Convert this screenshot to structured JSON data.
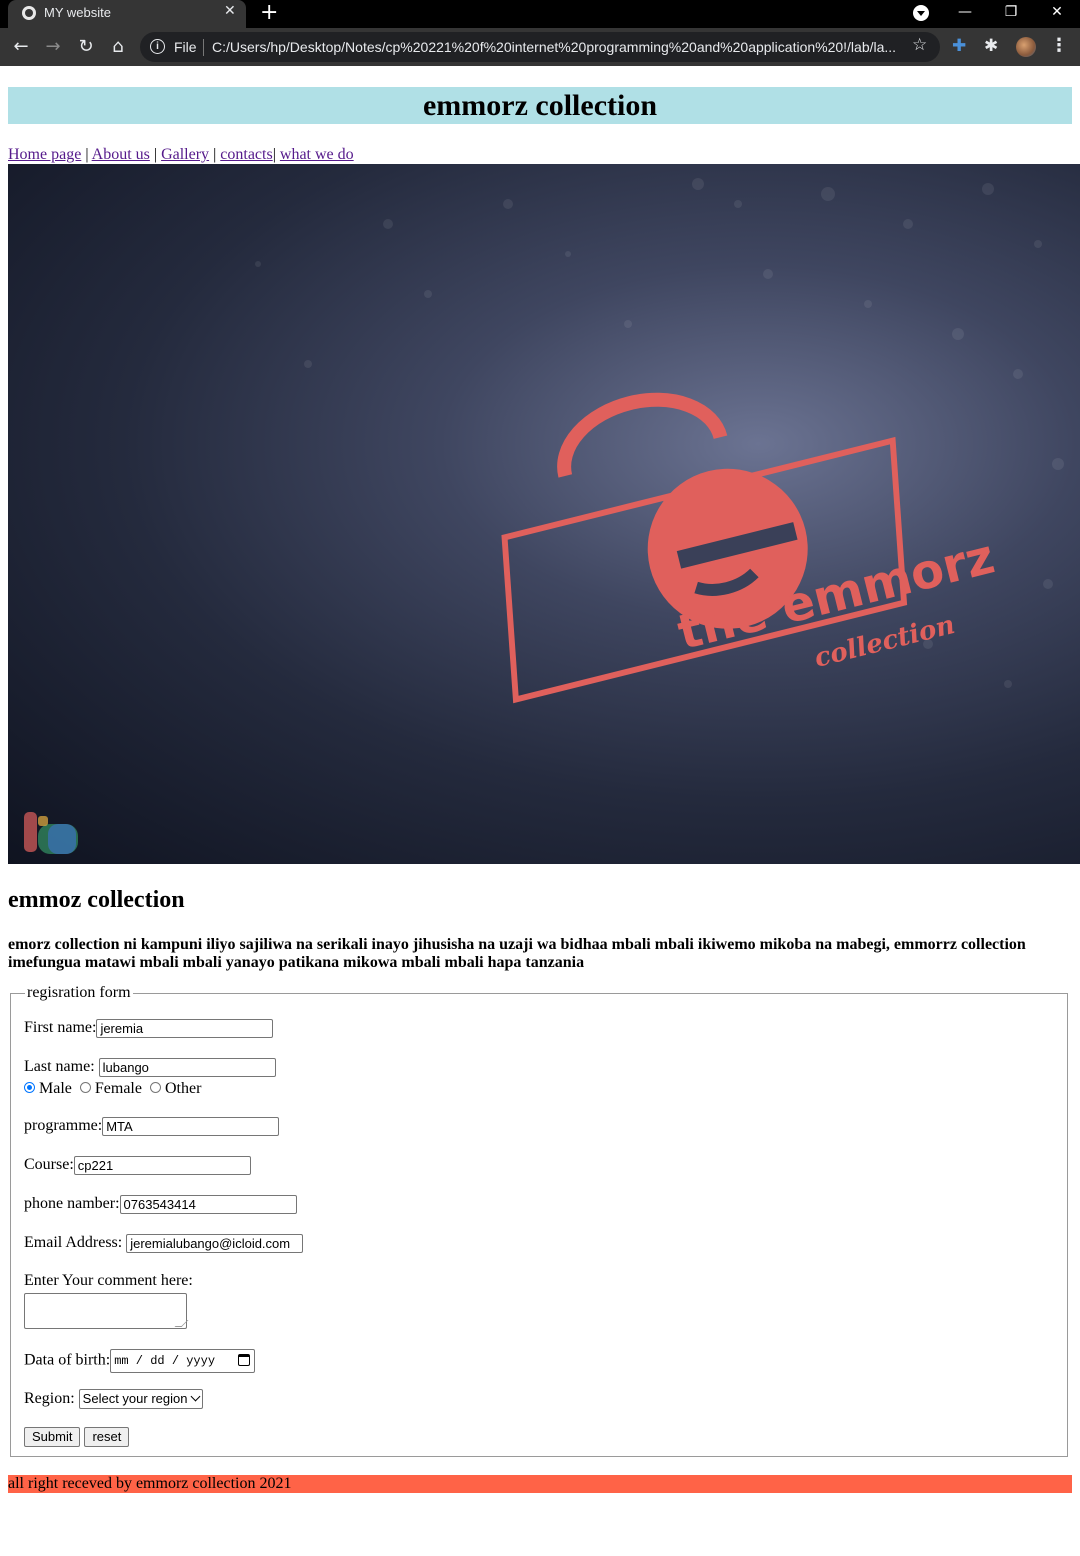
{
  "browser": {
    "tab_title": "MY website",
    "tab_close": "✕",
    "new_tab": "+",
    "window_controls": {
      "minimize": "—",
      "restore": "❐",
      "close": "✕"
    },
    "scheme": "File",
    "url": "C:/Users/hp/Desktop/Notes/cp%20221%20f%20internet%20programming%20and%20application%20!/lab/la...",
    "icons": [
      "globe-icon",
      "back-icon",
      "forward-icon",
      "reload-icon",
      "home-icon",
      "info-icon",
      "star-icon",
      "extension-icon",
      "puzzle-icon",
      "profile-avatar",
      "menu-icon"
    ]
  },
  "header": {
    "title": "emmorz collection"
  },
  "nav": {
    "links": [
      "Home page",
      "About us",
      "Gallery",
      "contacts",
      "what we do"
    ],
    "separator": "|"
  },
  "hero": {
    "logo_main": "the emmorz",
    "logo_sub": "collection",
    "colors": {
      "logo": "#e0605c",
      "background_dark": "#0f1320",
      "background_light": "#6b7392"
    }
  },
  "about": {
    "title": "emmoz collection",
    "text": "emorz collection ni kampuni iliyo sajiliwa na serikali inayo jihusisha na uzaji wa bidhaa mbali mbali ikiwemo mikoba na mabegi, emmorrz collection imefungua matawi mbali mbali yanayo patikana mikowa mbali mbali hapa tanzania"
  },
  "form": {
    "legend": "regisration form",
    "first_name": {
      "label": "First name:",
      "value": "jeremia"
    },
    "last_name": {
      "label": "Last name:",
      "value": "lubango"
    },
    "gender": {
      "options": [
        "Male",
        "Female",
        "Other"
      ],
      "selected": "Male"
    },
    "programme": {
      "label": "programme:",
      "value": "MTA"
    },
    "course": {
      "label": "Course:",
      "value": "cp221"
    },
    "phone": {
      "label": "phone namber:",
      "value": "0763543414"
    },
    "email": {
      "label": "Email Address:",
      "value": "jeremialubango@icloid.com"
    },
    "comment": {
      "label": "Enter Your comment here:",
      "value": ""
    },
    "dob": {
      "label": "Data of birth:",
      "placeholder": "mm / dd / yyyy"
    },
    "region": {
      "label": "Region:",
      "selected": "Select your region"
    },
    "submit_label": "Submit",
    "reset_label": "reset"
  },
  "footer": {
    "text": "all right receved by emmorz collection 2021"
  },
  "colors": {
    "header_bg": "#b0e0e6",
    "footer_bg": "#ff6347",
    "link_visited": "#551a8b",
    "radio_accent": "#0075ff"
  }
}
